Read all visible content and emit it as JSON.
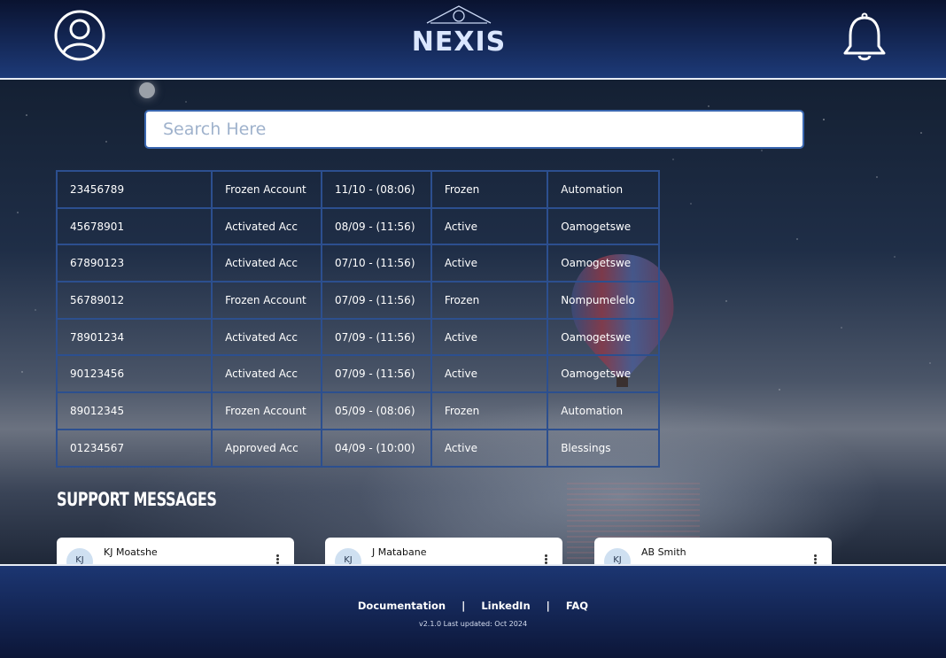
{
  "header": {
    "logo_text": "NEXIS",
    "profile_icon": "user-circle-icon",
    "notification_icon": "bell-icon"
  },
  "search": {
    "placeholder": "Search Here",
    "value": ""
  },
  "table": {
    "rows": [
      [
        "23456789",
        "Frozen Account",
        "11/10 - (08:06)",
        "Frozen",
        "Automation"
      ],
      [
        "45678901",
        "Activated Acc",
        "08/09 - (11:56)",
        "Active",
        "Oamogetswe"
      ],
      [
        "67890123",
        "Activated Acc",
        "07/10 - (11:56)",
        "Active",
        "Oamogetswe"
      ],
      [
        "56789012",
        "Frozen Account",
        "07/09 - (11:56)",
        "Frozen",
        "Nompumelelo"
      ],
      [
        "78901234",
        "Activated Acc",
        "07/09 - (11:56)",
        "Active",
        "Oamogetswe"
      ],
      [
        "90123456",
        "Activated Acc",
        "07/09 - (11:56)",
        "Active",
        "Oamogetswe"
      ],
      [
        "89012345",
        "Frozen Account",
        "05/09 - (08:06)",
        "Frozen",
        "Automation"
      ],
      [
        "01234567",
        "Approved Acc",
        "04/09 - (10:00)",
        "Active",
        "Blessings"
      ]
    ]
  },
  "support": {
    "title": "SUPPORT MESSAGES",
    "cards": [
      {
        "initials": "KJ",
        "name": "KJ Moatshe"
      },
      {
        "initials": "KJ",
        "name": "J Matabane"
      },
      {
        "initials": "KJ",
        "name": "AB Smith"
      }
    ]
  },
  "footer": {
    "links": [
      "Documentation",
      "LinkedIn",
      "FAQ"
    ],
    "separator": "|",
    "version": "v2.1.0  Last updated: Oct 2024"
  },
  "colors": {
    "header_bg": "#1d3a78",
    "table_border": "#2c4f8f",
    "search_border": "#3a67b0"
  }
}
